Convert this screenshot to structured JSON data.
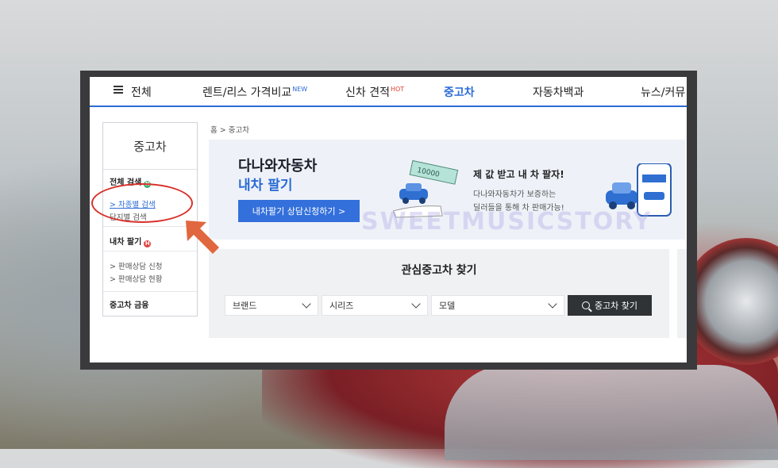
{
  "nav": {
    "all": "전체",
    "rent": "렌트/리스 가격비교",
    "rent_badge": "NEW",
    "newcar": "신차 견적",
    "newcar_badge": "HOT",
    "usedcar": "중고차",
    "encyclopedia": "자동차백과",
    "news": "뉴스/커뮤"
  },
  "breadcrumb": "홈 > 중고차",
  "sidebar": {
    "title": "중고차",
    "section1": "전체 검색",
    "link1": "> 차종별 검색",
    "link2": "단지별 검색",
    "section2": "내차 팔기",
    "link3": "> 판매상담 신청",
    "link4": "> 판매상담 현황",
    "section3": "중고차 금융"
  },
  "banner": {
    "brand": "다나와자동차",
    "subtitle": "내차 팔기",
    "button": "내차팔기 상담신청하기 >",
    "headline": "제 값 받고 내 차 팔자!",
    "desc1": "다나와자동차가 보증하는",
    "desc2": "딜러들을 통해 차 판매가능!",
    "money_label": "10000",
    "watermark": "SWEETMUSICSTORY"
  },
  "search": {
    "title": "관심중고차 찾기",
    "brand": "브랜드",
    "series": "시리즈",
    "model": "모델",
    "button": "중고차 찾기"
  },
  "colors": {
    "accent": "#2b6bd6",
    "annotation": "#d8322c",
    "hot": "#e23b2b"
  }
}
